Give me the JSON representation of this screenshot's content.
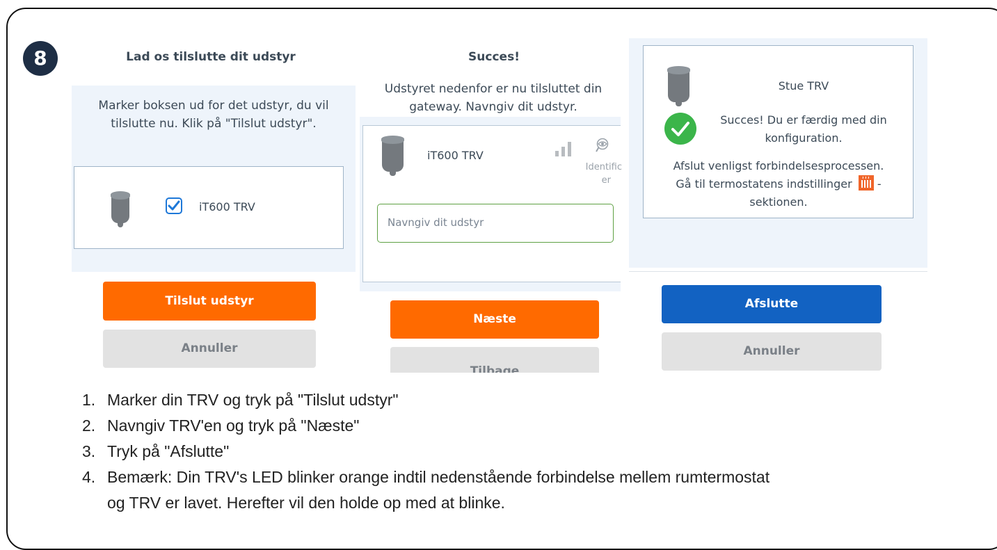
{
  "step_number": "8",
  "panel1": {
    "title": "Lad os tilslutte dit udstyr",
    "message": "Marker boksen ud for det udstyr, du vil tilslutte nu. Klik på \"Tilslut udstyr\".",
    "device_name": "iT600 TRV",
    "checked": true,
    "primary_button": "Tilslut udstyr",
    "secondary_button": "Annuller"
  },
  "panel2": {
    "title": "Succes!",
    "message": "Udstyret nedenfor er nu tilsluttet din gateway. Navngiv dit udstyr.",
    "device_name": "iT600 TRV",
    "identify_label_line1": "Identific",
    "identify_label_line2": "er",
    "name_placeholder": "Navngiv dit udstyr",
    "primary_button": "Næste",
    "secondary_button": "Tilbage"
  },
  "panel3": {
    "device_name": "Stue TRV",
    "success_line1": "Succes! Du er færdig med din",
    "success_line2": "konfiguration.",
    "info_line1": "Afslut venligst forbindelsesprocessen.",
    "info_line2_before": "Gå til termostatens indstillinger",
    "info_line2_after": " -",
    "info_line3": "sektionen.",
    "primary_button": "Afslutte",
    "secondary_button": "Annuller"
  },
  "instructions": [
    {
      "num": "1.",
      "text": "Marker din TRV og tryk på  \"Tilslut udstyr\""
    },
    {
      "num": "2.",
      "text": "Navngiv TRV'en og tryk på \"Næste\""
    },
    {
      "num": "3.",
      "text": "Tryk på \"Afslutte\""
    },
    {
      "num": "4.",
      "text": "Bemærk: Din TRV's LED blinker orange indtil nedenstående forbindelse mellem rumtermostat"
    },
    {
      "num": "",
      "text": "og TRV er lavet. Herefter vil den holde op med at blinke."
    }
  ],
  "colors": {
    "orange": "#ff6a00",
    "blue": "#1262c2",
    "success_green": "#3bb54a",
    "badge": "#1e2e45"
  }
}
